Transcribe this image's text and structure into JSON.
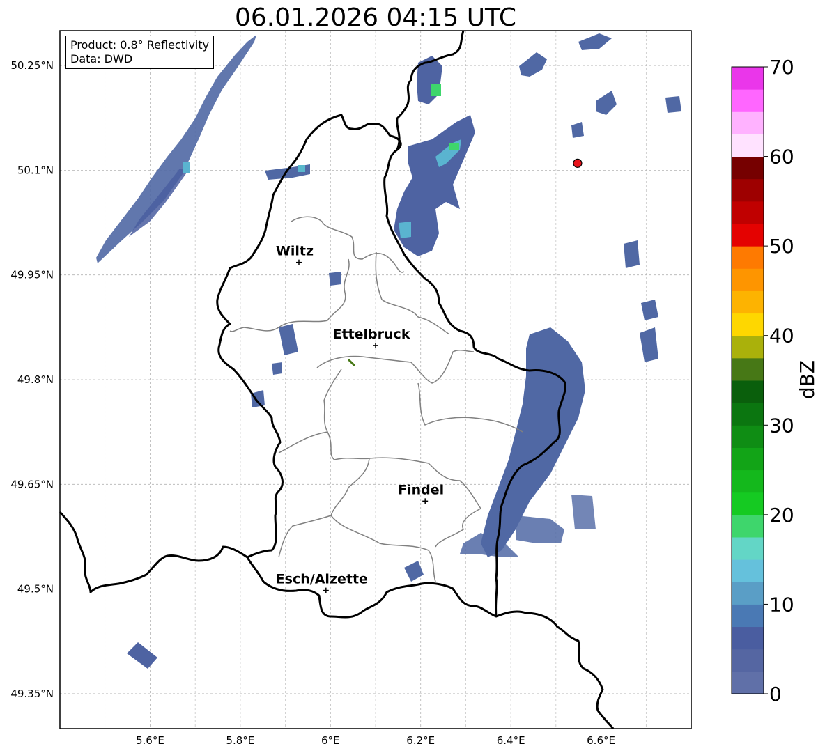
{
  "title": "06.01.2026 04:15 UTC",
  "info": {
    "product": "Product: 0.8° Reflectivity",
    "data": "Data: DWD"
  },
  "axes": {
    "lat_ticks": [
      "50.25°N",
      "50.1°N",
      "49.95°N",
      "49.8°N",
      "49.65°N",
      "49.5°N",
      "49.35°N"
    ],
    "lon_ticks": [
      "5.6°E",
      "5.8°E",
      "6°E",
      "6.2°E",
      "6.4°E",
      "6.6°E"
    ],
    "lon_range": [
      5.4,
      6.8
    ],
    "lat_range": [
      49.3,
      50.3
    ]
  },
  "cities": [
    {
      "name": "Wiltz",
      "lon": 5.93,
      "lat": 49.968
    },
    {
      "name": "Ettelbruck",
      "lon": 6.1,
      "lat": 49.849
    },
    {
      "name": "Findel",
      "lon": 6.21,
      "lat": 49.626
    },
    {
      "name": "Esch/Alzette",
      "lon": 5.99,
      "lat": 49.498
    }
  ],
  "radar_site": {
    "lon": 6.548,
    "lat": 50.11,
    "color": "#e8131b"
  },
  "colorbar": {
    "label": "dBZ",
    "ticks": [
      "0",
      "10",
      "20",
      "30",
      "40",
      "50",
      "60",
      "70"
    ],
    "min": 0,
    "max": 70,
    "step": 2.5,
    "colors": [
      "#6070a8",
      "#5566a2",
      "#4a5da0",
      "#4a79b4",
      "#5a9ec6",
      "#65c1dc",
      "#63d6c6",
      "#3ed66c",
      "#15ca22",
      "#14b81c",
      "#12a417",
      "#0f8d14",
      "#0b7610",
      "#0a5f0c",
      "#477816",
      "#aab10b",
      "#fed700",
      "#fdb301",
      "#fe9500",
      "#fe7a01",
      "#e40201",
      "#c00000",
      "#9e0000",
      "#760000",
      "#ffe2ff",
      "#ffb2ff",
      "#ff66ff",
      "#ea36ea"
    ]
  },
  "colors": {
    "border": "#000000",
    "canton_border": "#808080",
    "grid": "#b4b4b4"
  }
}
